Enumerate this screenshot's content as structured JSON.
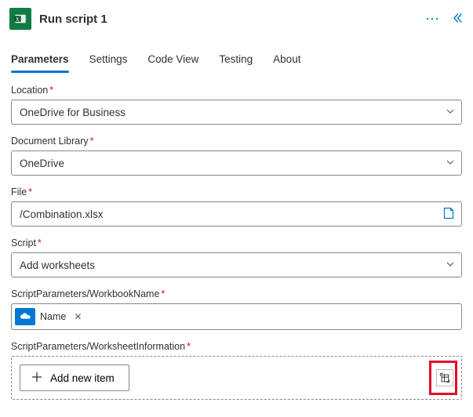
{
  "header": {
    "title": "Run script 1"
  },
  "tabs": [
    {
      "label": "Parameters",
      "active": true
    },
    {
      "label": "Settings"
    },
    {
      "label": "Code View"
    },
    {
      "label": "Testing"
    },
    {
      "label": "About"
    }
  ],
  "fields": {
    "location": {
      "label": "Location",
      "value": "OneDrive for Business"
    },
    "documentLibrary": {
      "label": "Document Library",
      "value": "OneDrive"
    },
    "file": {
      "label": "File",
      "value": "/Combination.xlsx"
    },
    "script": {
      "label": "Script",
      "value": "Add worksheets"
    },
    "workbookName": {
      "label": "ScriptParameters/WorkbookName",
      "token": "Name"
    },
    "worksheetInfo": {
      "label": "ScriptParameters/WorksheetInformation",
      "addLabel": "Add new item"
    }
  }
}
